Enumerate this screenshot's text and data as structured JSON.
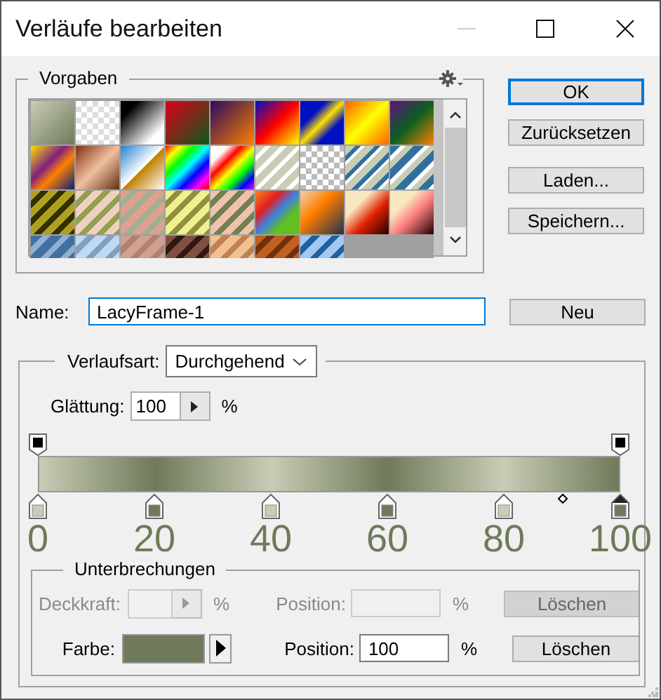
{
  "window": {
    "title": "Verläufe bearbeiten"
  },
  "presets": {
    "label": "Vorgaben"
  },
  "buttons": [
    {
      "label": "OK",
      "default": true
    },
    {
      "label": "Zurücksetzen",
      "default": false
    },
    {
      "label": "Laden...",
      "default": false
    },
    {
      "label": "Speichern...",
      "default": false
    }
  ],
  "name_field": {
    "label": "Name:",
    "value": "LacyFrame-1",
    "focused": true
  },
  "new_button": "Neu",
  "gradient_type": {
    "label": "Verlaufsart:",
    "value": "Durchgehend"
  },
  "smoothness": {
    "label": "Glättung:",
    "value": "100",
    "unit": "%"
  },
  "opacity_stops": [
    {
      "level": 0,
      "selected": false
    },
    {
      "level": 1,
      "selected": false
    }
  ],
  "color_stops": [
    {
      "level": 0,
      "color": "#c8cdb6",
      "selected": false
    },
    {
      "level": 0.2,
      "color": "#6f7a5a",
      "selected": false
    },
    {
      "level": 0.4,
      "color": "#c8cdb6",
      "selected": false
    },
    {
      "level": 0.6,
      "color": "#6f7a5a",
      "selected": false
    },
    {
      "level": 0.8,
      "color": "#c8cdb6",
      "selected": false
    },
    {
      "level": 1,
      "color": "#6f7a5a",
      "selected": true
    }
  ],
  "stops_panel": {
    "title": "Unterbrechungen",
    "opacity_row": {
      "label": "Deckkraft:",
      "unit": "%",
      "position_label": "Position:",
      "position_unit": "%",
      "delete_label": "Löschen",
      "disabled": true
    },
    "color_row": {
      "label": "Farbe:",
      "color": "#6f7a5a",
      "position_label": "Position:",
      "position_value": "100",
      "position_unit": "%",
      "delete_label": "Löschen",
      "disabled": false
    }
  },
  "scale_labels": [
    "0",
    "20",
    "40",
    "60",
    "80",
    "100"
  ]
}
